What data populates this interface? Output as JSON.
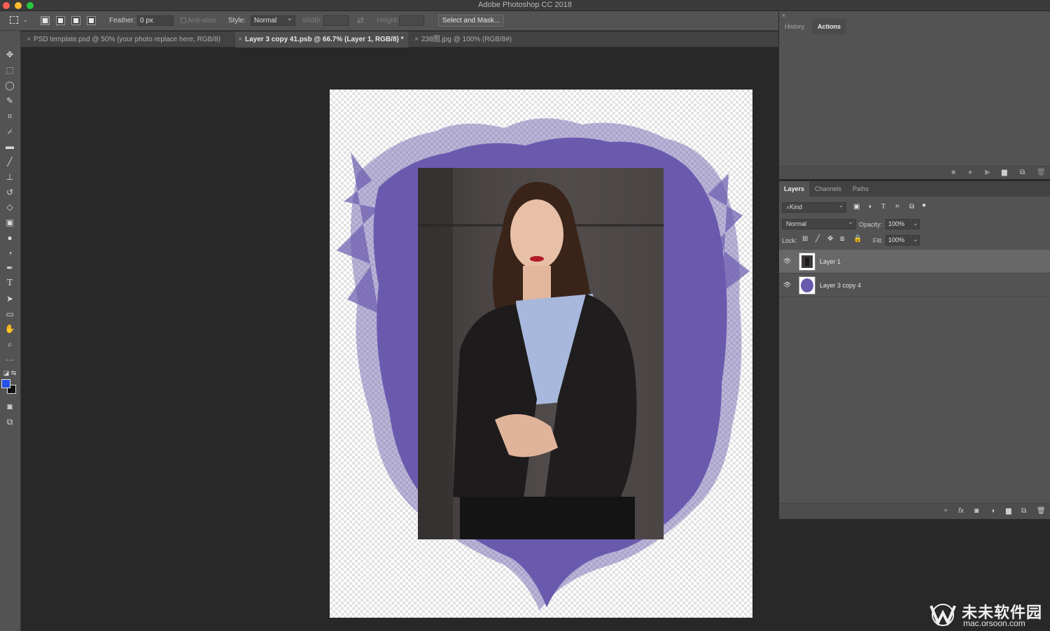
{
  "window": {
    "title": "Adobe Photoshop CC 2018"
  },
  "options_bar": {
    "feather_label": "Feather:",
    "feather_value": "0 px",
    "anti_alias_label": "Anti-alias",
    "style_label": "Style:",
    "style_value": "Normal",
    "width_label": "Width:",
    "height_label": "Height:",
    "select_mask_label": "Select and Mask..."
  },
  "tabs": [
    {
      "label": "PSD template.psd @ 50% (your photo replace here, RGB/8)",
      "active": false
    },
    {
      "label": "Layer 3 copy 41.psb @ 66.7% (Layer 1, RGB/8) *",
      "active": true
    },
    {
      "label": "238图.jpg @ 100% (RGB/8#)",
      "active": false
    }
  ],
  "tools": [
    "move-tool-icon",
    "marquee-tool-icon",
    "lasso-tool-icon",
    "quick-select-icon",
    "crop-tool-icon",
    "eyedropper-icon",
    "healing-brush-icon",
    "brush-icon",
    "clone-stamp-icon",
    "history-brush-icon",
    "eraser-icon",
    "gradient-icon",
    "blur-icon",
    "dodge-icon",
    "pen-icon",
    "type-icon",
    "path-select-icon",
    "rectangle-icon",
    "hand-icon",
    "zoom-icon",
    "more-tools-icon"
  ],
  "colors": {
    "foreground": "#2551e6",
    "background": "#111111",
    "splash": "#6a5aae",
    "canvas": "#282828",
    "panel": "#535353"
  },
  "history_panel": {
    "tabs": [
      {
        "label": "History",
        "active": false
      },
      {
        "label": "Actions",
        "active": true
      }
    ]
  },
  "layers_panel": {
    "tabs": [
      {
        "label": "Layers",
        "active": true
      },
      {
        "label": "Channels",
        "active": false
      },
      {
        "label": "Paths",
        "active": false
      }
    ],
    "filter_label": "Kind",
    "blend_mode": "Normal",
    "opacity_label": "Opacity:",
    "opacity_value": "100%",
    "lock_label": "Lock:",
    "fill_label": "Fill:",
    "fill_value": "100%",
    "layers": [
      {
        "name": "Layer 1",
        "visible": true,
        "selected": true
      },
      {
        "name": "Layer 3 copy 4",
        "visible": true,
        "selected": false
      }
    ]
  },
  "watermark": {
    "name": "未未软件园",
    "url": "mac.orsoon.com"
  }
}
